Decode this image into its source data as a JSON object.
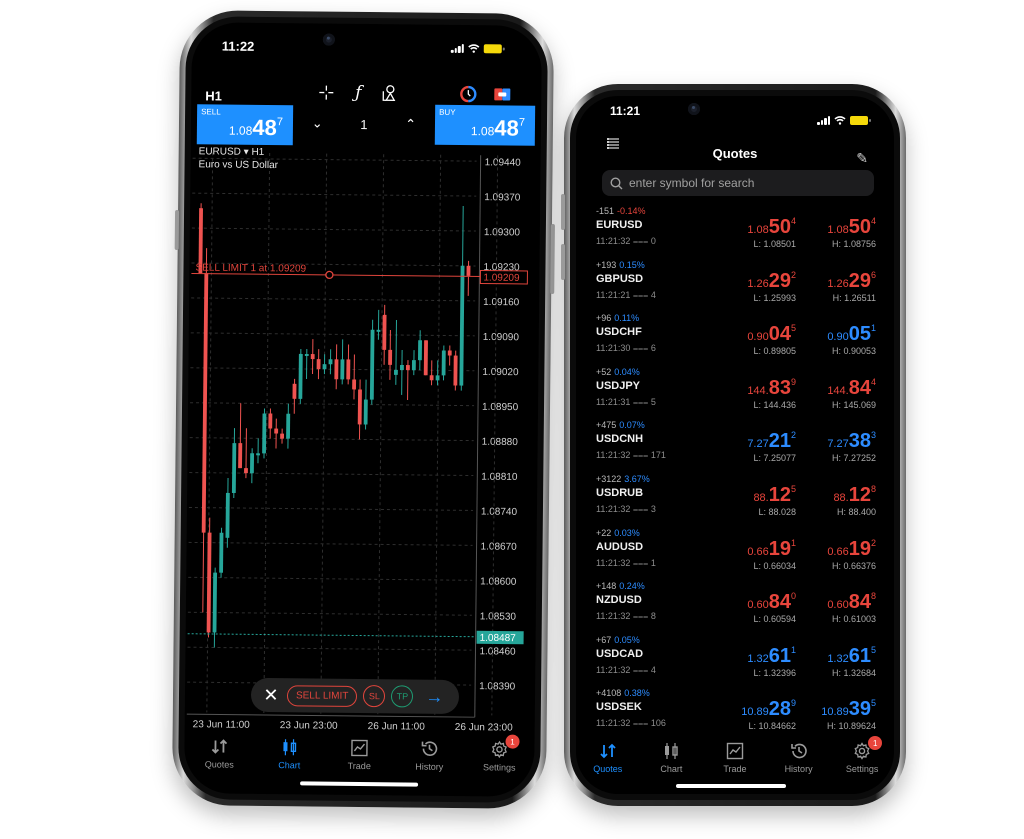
{
  "colors": {
    "accent_blue": "#1e90ff",
    "bull": "#26a69a",
    "bear": "#ef5350",
    "sell_limit": "#e0453c",
    "tp_green": "#1e9d73",
    "badge_red": "#e8453c",
    "battery": "#f5d90a"
  },
  "left_phone": {
    "status": {
      "time": "11:22"
    },
    "toolbar": {
      "timeframe": "H1",
      "icons": [
        "crosshair-icon",
        "function-icon",
        "objects-icon",
        "one-click-trading-icon",
        "chart-toggle-icon"
      ]
    },
    "trade_panel": {
      "sell": {
        "caption": "SELL",
        "prefix": "1.08",
        "big": "48",
        "sup": "7"
      },
      "buy": {
        "caption": "BUY",
        "prefix": "1.08",
        "big": "48",
        "sup": "7"
      },
      "volume": "1",
      "decrease_icon": "chevron-down-icon",
      "increase_icon": "chevron-up-icon"
    },
    "symbol_header": {
      "symbol": "EURUSD ▾ H1",
      "description": "Euro vs US Dollar"
    },
    "order_toolbar": {
      "close_label": "✕",
      "sell_limit_label": "SELL LIMIT",
      "sl_label": "SL",
      "tp_label": "TP",
      "next_label": "→"
    },
    "tabs": [
      {
        "label": "Quotes",
        "icon": "quotes-arrows-icon",
        "active": false
      },
      {
        "label": "Chart",
        "icon": "candlestick-icon",
        "active": true
      },
      {
        "label": "Trade",
        "icon": "trade-chart-icon",
        "active": false
      },
      {
        "label": "History",
        "icon": "history-clock-icon",
        "active": false
      },
      {
        "label": "Settings",
        "icon": "settings-gear-icon",
        "active": false,
        "badge": "1"
      }
    ]
  },
  "chart_data": {
    "type": "candlestick",
    "symbol": "EURUSD",
    "timeframe": "H1",
    "title": "EURUSD ▾ H1",
    "subtitle": "Euro vs US Dollar",
    "y_ticks": [
      "1.09440",
      "1.09370",
      "1.09300",
      "1.09230",
      "1.09160",
      "1.09090",
      "1.09020",
      "1.08950",
      "1.08880",
      "1.08810",
      "1.08740",
      "1.08670",
      "1.08600",
      "1.08530",
      "1.08460",
      "1.08390"
    ],
    "ylim": [
      1.0836,
      1.0946
    ],
    "x_ticks": [
      "23 Jun 11:00",
      "23 Jun 23:00",
      "26 Jun 11:00",
      "26 Jun 23:00"
    ],
    "grid": true,
    "current_price": {
      "label": "1.08487",
      "value": 1.08487
    },
    "sell_limit": {
      "text": "SELL LIMIT 1 at 1.09209",
      "label": "1.09209",
      "value": 1.09209
    },
    "candles": [
      {
        "o": 1.0934,
        "h": 1.0935,
        "l": 1.0921,
        "c": 1.0921
      },
      {
        "o": 1.0921,
        "h": 1.0926,
        "l": 1.0853,
        "c": 1.0869
      },
      {
        "o": 1.0869,
        "h": 1.0872,
        "l": 1.0848,
        "c": 1.0849
      },
      {
        "o": 1.0849,
        "h": 1.0862,
        "l": 1.0846,
        "c": 1.0861
      },
      {
        "o": 1.0861,
        "h": 1.087,
        "l": 1.086,
        "c": 1.0869
      },
      {
        "o": 1.0868,
        "h": 1.088,
        "l": 1.0866,
        "c": 1.0877
      },
      {
        "o": 1.0877,
        "h": 1.089,
        "l": 1.0876,
        "c": 1.0887
      },
      {
        "o": 1.0887,
        "h": 1.0895,
        "l": 1.0882,
        "c": 1.0882
      },
      {
        "o": 1.0882,
        "h": 1.089,
        "l": 1.088,
        "c": 1.0881
      },
      {
        "o": 1.0881,
        "h": 1.0886,
        "l": 1.0879,
        "c": 1.0885
      },
      {
        "o": 1.0885,
        "h": 1.0888,
        "l": 1.0883,
        "c": 1.0885
      },
      {
        "o": 1.0885,
        "h": 1.0894,
        "l": 1.0884,
        "c": 1.0893
      },
      {
        "o": 1.0893,
        "h": 1.0894,
        "l": 1.0888,
        "c": 1.089
      },
      {
        "o": 1.089,
        "h": 1.0892,
        "l": 1.0886,
        "c": 1.0889
      },
      {
        "o": 1.0889,
        "h": 1.089,
        "l": 1.0887,
        "c": 1.0888
      },
      {
        "o": 1.0888,
        "h": 1.0895,
        "l": 1.0886,
        "c": 1.0893
      },
      {
        "o": 1.0899,
        "h": 1.09,
        "l": 1.0893,
        "c": 1.0896
      },
      {
        "o": 1.0896,
        "h": 1.0906,
        "l": 1.0895,
        "c": 1.0905
      },
      {
        "o": 1.0905,
        "h": 1.0906,
        "l": 1.09,
        "c": 1.0905
      },
      {
        "o": 1.0905,
        "h": 1.0908,
        "l": 1.0901,
        "c": 1.0904
      },
      {
        "o": 1.0904,
        "h": 1.0906,
        "l": 1.09,
        "c": 1.0902
      },
      {
        "o": 1.0902,
        "h": 1.0905,
        "l": 1.0901,
        "c": 1.0903
      },
      {
        "o": 1.0903,
        "h": 1.0906,
        "l": 1.0901,
        "c": 1.0904
      },
      {
        "o": 1.0904,
        "h": 1.0907,
        "l": 1.0898,
        "c": 1.09
      },
      {
        "o": 1.09,
        "h": 1.0908,
        "l": 1.0899,
        "c": 1.0904
      },
      {
        "o": 1.0904,
        "h": 1.0907,
        "l": 1.0899,
        "c": 1.09
      },
      {
        "o": 1.09,
        "h": 1.0905,
        "l": 1.0896,
        "c": 1.0898
      },
      {
        "o": 1.0898,
        "h": 1.09,
        "l": 1.0888,
        "c": 1.0891
      },
      {
        "o": 1.0891,
        "h": 1.09,
        "l": 1.089,
        "c": 1.0896
      },
      {
        "o": 1.0896,
        "h": 1.0912,
        "l": 1.0895,
        "c": 1.091
      },
      {
        "o": 1.091,
        "h": 1.0914,
        "l": 1.0908,
        "c": 1.091
      },
      {
        "o": 1.0913,
        "h": 1.0915,
        "l": 1.0903,
        "c": 1.0906
      },
      {
        "o": 1.0906,
        "h": 1.091,
        "l": 1.09,
        "c": 1.0903
      },
      {
        "o": 1.0901,
        "h": 1.0912,
        "l": 1.0899,
        "c": 1.0902
      },
      {
        "o": 1.0902,
        "h": 1.0906,
        "l": 1.0897,
        "c": 1.0903
      },
      {
        "o": 1.0903,
        "h": 1.0904,
        "l": 1.0896,
        "c": 1.0902
      },
      {
        "o": 1.0902,
        "h": 1.0906,
        "l": 1.0901,
        "c": 1.0904
      },
      {
        "o": 1.0904,
        "h": 1.091,
        "l": 1.0902,
        "c": 1.0908
      },
      {
        "o": 1.0908,
        "h": 1.0908,
        "l": 1.0901,
        "c": 1.0901
      },
      {
        "o": 1.0901,
        "h": 1.0904,
        "l": 1.0899,
        "c": 1.09
      },
      {
        "o": 1.09,
        "h": 1.0904,
        "l": 1.0899,
        "c": 1.0901
      },
      {
        "o": 1.0901,
        "h": 1.0907,
        "l": 1.09,
        "c": 1.0906
      },
      {
        "o": 1.0906,
        "h": 1.0907,
        "l": 1.0903,
        "c": 1.0905
      },
      {
        "o": 1.0905,
        "h": 1.0906,
        "l": 1.0898,
        "c": 1.0899
      },
      {
        "o": 1.0899,
        "h": 1.0935,
        "l": 1.0898,
        "c": 1.0923
      },
      {
        "o": 1.0923,
        "h": 1.0924,
        "l": 1.0917,
        "c": 1.0921
      }
    ]
  },
  "right_phone": {
    "status": {
      "time": "11:21"
    },
    "header": {
      "title": "Quotes",
      "menu_icon": "list-menu-icon",
      "edit_icon": "pencil-edit-icon"
    },
    "search": {
      "placeholder": "enter symbol for search",
      "value": ""
    },
    "quotes": [
      {
        "change": "-151",
        "pct": "-0.14%",
        "dir": "down",
        "symbol": "EURUSD",
        "time": "11:21:32",
        "spread": "0",
        "bid": {
          "pre": "1.08",
          "big": "50",
          "sup": "4",
          "color": "red"
        },
        "ask": {
          "pre": "1.08",
          "big": "50",
          "sup": "4",
          "color": "red"
        },
        "low": "L: 1.08501",
        "high": "H: 1.08756"
      },
      {
        "change": "+193",
        "pct": "0.15%",
        "dir": "up",
        "symbol": "GBPUSD",
        "time": "11:21:21",
        "spread": "4",
        "bid": {
          "pre": "1.26",
          "big": "29",
          "sup": "2",
          "color": "red"
        },
        "ask": {
          "pre": "1.26",
          "big": "29",
          "sup": "6",
          "color": "red"
        },
        "low": "L: 1.25993",
        "high": "H: 1.26511"
      },
      {
        "change": "+96",
        "pct": "0.11%",
        "dir": "up",
        "symbol": "USDCHF",
        "time": "11:21:30",
        "spread": "6",
        "bid": {
          "pre": "0.90",
          "big": "04",
          "sup": "5",
          "color": "red"
        },
        "ask": {
          "pre": "0.90",
          "big": "05",
          "sup": "1",
          "color": "blue"
        },
        "low": "L: 0.89805",
        "high": "H: 0.90053"
      },
      {
        "change": "+52",
        "pct": "0.04%",
        "dir": "up",
        "symbol": "USDJPY",
        "time": "11:21:31",
        "spread": "5",
        "bid": {
          "pre": "144.",
          "big": "83",
          "sup": "9",
          "color": "red"
        },
        "ask": {
          "pre": "144.",
          "big": "84",
          "sup": "4",
          "color": "red"
        },
        "low": "L: 144.436",
        "high": "H: 145.069"
      },
      {
        "change": "+475",
        "pct": "0.07%",
        "dir": "up",
        "symbol": "USDCNH",
        "time": "11:21:32",
        "spread": "171",
        "bid": {
          "pre": "7.27",
          "big": "21",
          "sup": "2",
          "color": "blue"
        },
        "ask": {
          "pre": "7.27",
          "big": "38",
          "sup": "3",
          "color": "blue"
        },
        "low": "L: 7.25077",
        "high": "H: 7.27252"
      },
      {
        "change": "+3122",
        "pct": "3.67%",
        "dir": "up",
        "symbol": "USDRUB",
        "time": "11:21:32",
        "spread": "3",
        "bid": {
          "pre": "88.",
          "big": "12",
          "sup": "5",
          "color": "red"
        },
        "ask": {
          "pre": "88.",
          "big": "12",
          "sup": "8",
          "color": "red"
        },
        "low": "L: 88.028",
        "high": "H: 88.400"
      },
      {
        "change": "+22",
        "pct": "0.03%",
        "dir": "up",
        "symbol": "AUDUSD",
        "time": "11:21:32",
        "spread": "1",
        "bid": {
          "pre": "0.66",
          "big": "19",
          "sup": "1",
          "color": "red"
        },
        "ask": {
          "pre": "0.66",
          "big": "19",
          "sup": "2",
          "color": "red"
        },
        "low": "L: 0.66034",
        "high": "H: 0.66376"
      },
      {
        "change": "+148",
        "pct": "0.24%",
        "dir": "up",
        "symbol": "NZDUSD",
        "time": "11:21:32",
        "spread": "8",
        "bid": {
          "pre": "0.60",
          "big": "84",
          "sup": "0",
          "color": "red"
        },
        "ask": {
          "pre": "0.60",
          "big": "84",
          "sup": "8",
          "color": "red"
        },
        "low": "L: 0.60594",
        "high": "H: 0.61003"
      },
      {
        "change": "+67",
        "pct": "0.05%",
        "dir": "up",
        "symbol": "USDCAD",
        "time": "11:21:32",
        "spread": "4",
        "bid": {
          "pre": "1.32",
          "big": "61",
          "sup": "1",
          "color": "blue"
        },
        "ask": {
          "pre": "1.32",
          "big": "61",
          "sup": "5",
          "color": "blue"
        },
        "low": "L: 1.32396",
        "high": "H: 1.32684"
      },
      {
        "change": "+4108",
        "pct": "0.38%",
        "dir": "up",
        "symbol": "USDSEK",
        "time": "11:21:32",
        "spread": "106",
        "bid": {
          "pre": "10.89",
          "big": "28",
          "sup": "9",
          "color": "blue"
        },
        "ask": {
          "pre": "10.89",
          "big": "39",
          "sup": "5",
          "color": "blue"
        },
        "low": "L: 10.84662",
        "high": "H: 10.89624"
      }
    ],
    "tabs": [
      {
        "label": "Quotes",
        "icon": "quotes-arrows-icon",
        "active": true
      },
      {
        "label": "Chart",
        "icon": "candlestick-icon",
        "active": false
      },
      {
        "label": "Trade",
        "icon": "trade-chart-icon",
        "active": false
      },
      {
        "label": "History",
        "icon": "history-clock-icon",
        "active": false
      },
      {
        "label": "Settings",
        "icon": "settings-gear-icon",
        "active": false,
        "badge": "1"
      }
    ]
  }
}
